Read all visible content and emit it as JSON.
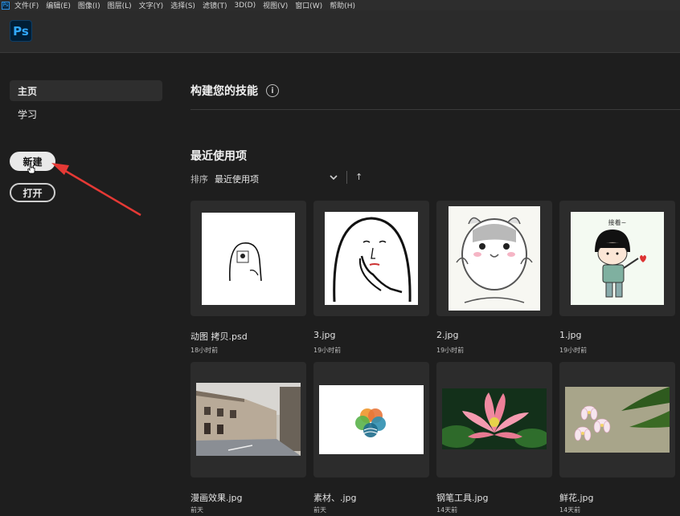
{
  "menubar": {
    "app_icon": "Ps",
    "items": [
      "文件(F)",
      "编辑(E)",
      "图像(I)",
      "图层(L)",
      "文字(Y)",
      "选择(S)",
      "滤镜(T)",
      "3D(D)",
      "视图(V)",
      "窗口(W)",
      "帮助(H)"
    ]
  },
  "header": {
    "logo": "Ps"
  },
  "sidebar": {
    "items": [
      {
        "label": "主页",
        "active": true
      },
      {
        "label": "学习",
        "active": false
      }
    ],
    "new_button": "新建",
    "open_button": "打开"
  },
  "main": {
    "skills_title": "构建您的技能",
    "info_icon": "i",
    "recent_title": "最近使用项",
    "sort_label": "排序",
    "sort_value": "最近使用项",
    "sort_direction": "↑",
    "files": [
      {
        "name": "动图 拷贝.psd",
        "time": "18小时前",
        "thumb_icon": "ghost-doodle-mini"
      },
      {
        "name": "3.jpg",
        "time": "19小时前",
        "thumb_icon": "ghost-doodle"
      },
      {
        "name": "2.jpg",
        "time": "19小时前",
        "thumb_icon": "hamster-sticker"
      },
      {
        "name": "1.jpg",
        "time": "19小时前",
        "thumb_icon": "girl-sticker",
        "thumb_caption": "接着~"
      },
      {
        "name": "漫画效果.jpg",
        "time": "前天",
        "thumb_icon": "street-photo"
      },
      {
        "name": "素材、.jpg",
        "time": "前天",
        "thumb_icon": "circle-logo"
      },
      {
        "name": "钢笔工具.jpg",
        "time": "14天前",
        "thumb_icon": "lotus-photo"
      },
      {
        "name": "鲜花.jpg",
        "time": "14天前",
        "thumb_icon": "plumeria-photo"
      }
    ]
  },
  "colors": {
    "background": "#1e1e1e",
    "accent": "#31a8ff",
    "arrow": "#e53935"
  }
}
